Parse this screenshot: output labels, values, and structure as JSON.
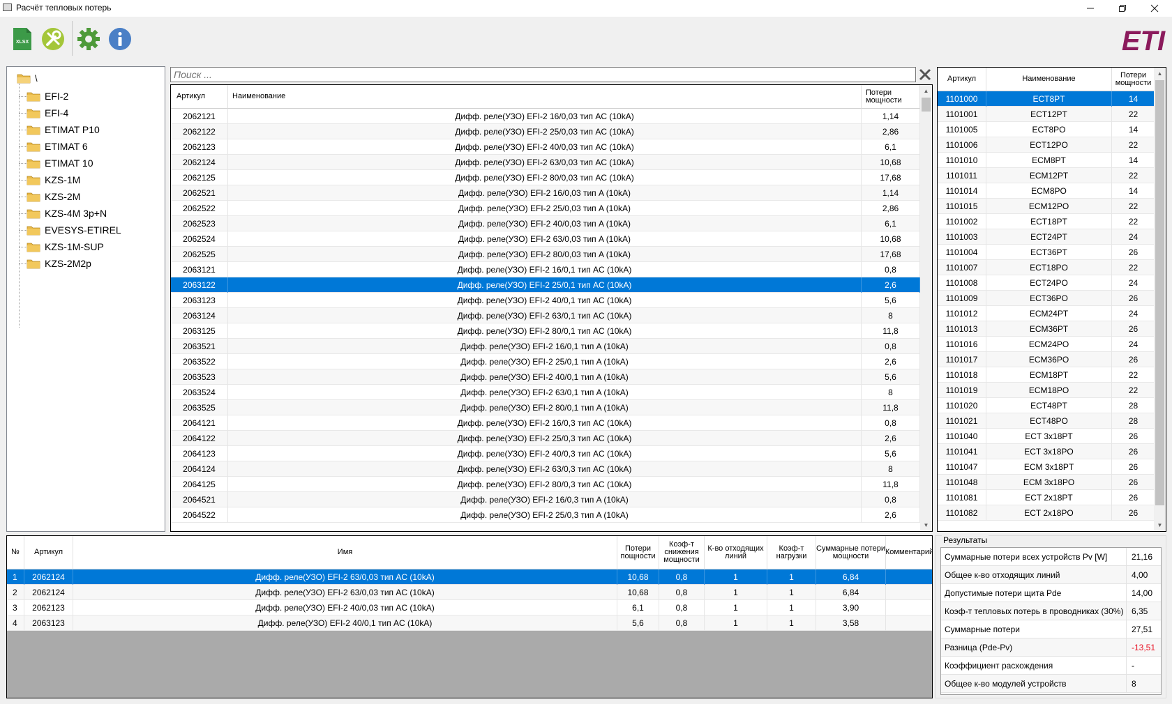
{
  "window": {
    "title": "Расчёт тепловых потерь",
    "brand": "ETI"
  },
  "toolbar": {
    "buttons": [
      {
        "name": "xlsx",
        "icon": "xlsx-file-icon",
        "label": "XLSX"
      },
      {
        "name": "tools",
        "icon": "tools-icon"
      },
      {
        "name": "settings",
        "icon": "gear-icon"
      },
      {
        "name": "info",
        "icon": "info-icon"
      }
    ]
  },
  "tree": {
    "root": "\\",
    "items": [
      "EFI-2",
      "EFI-4",
      "ETIMAT P10",
      "ETIMAT 6",
      "ETIMAT 10",
      "KZS-1M",
      "KZS-2M",
      "KZS-4M 3p+N",
      "EVESYS-ETIREL",
      "KZS-1M-SUP",
      "KZS-2M2p"
    ]
  },
  "search": {
    "placeholder": "Поиск ..."
  },
  "products": {
    "headers": [
      "Артикул",
      "Наименование",
      "Потери мощности"
    ],
    "selected_index": 11,
    "rows": [
      [
        "2062121",
        "Дифф. реле(УЗО) EFI-2 16/0,03 тип AC (10kA)",
        "1,14"
      ],
      [
        "2062122",
        "Дифф. реле(УЗО) EFI-2 25/0,03 тип AC (10kA)",
        "2,86"
      ],
      [
        "2062123",
        "Дифф. реле(УЗО) EFI-2 40/0,03 тип AC (10kA)",
        "6,1"
      ],
      [
        "2062124",
        "Дифф. реле(УЗО) EFI-2 63/0,03 тип AC (10kA)",
        "10,68"
      ],
      [
        "2062125",
        "Дифф. реле(УЗО) EFI-2 80/0,03 тип AC (10kA)",
        "17,68"
      ],
      [
        "2062521",
        "Дифф. реле(УЗО) EFI-2 16/0,03 тип A (10kA)",
        "1,14"
      ],
      [
        "2062522",
        "Дифф. реле(УЗО) EFI-2 25/0,03 тип A (10kA)",
        "2,86"
      ],
      [
        "2062523",
        "Дифф. реле(УЗО) EFI-2 40/0,03 тип A (10kA)",
        "6,1"
      ],
      [
        "2062524",
        "Дифф. реле(УЗО) EFI-2 63/0,03 тип A (10kA)",
        "10,68"
      ],
      [
        "2062525",
        "Дифф. реле(УЗО) EFI-2 80/0,03 тип A (10kA)",
        "17,68"
      ],
      [
        "2063121",
        "Дифф. реле(УЗО) EFI-2 16/0,1 тип AC (10kA)",
        "0,8"
      ],
      [
        "2063122",
        "Дифф. реле(УЗО) EFI-2 25/0,1 тип AC (10kA)",
        "2,6"
      ],
      [
        "2063123",
        "Дифф. реле(УЗО) EFI-2 40/0,1 тип AC (10kA)",
        "5,6"
      ],
      [
        "2063124",
        "Дифф. реле(УЗО) EFI-2 63/0,1 тип AC (10kA)",
        "8"
      ],
      [
        "2063125",
        "Дифф. реле(УЗО) EFI-2 80/0,1 тип AC (10kA)",
        "11,8"
      ],
      [
        "2063521",
        "Дифф. реле(УЗО) EFI-2 16/0,1 тип A (10kA)",
        "0,8"
      ],
      [
        "2063522",
        "Дифф. реле(УЗО) EFI-2 25/0,1 тип A (10kA)",
        "2,6"
      ],
      [
        "2063523",
        "Дифф. реле(УЗО) EFI-2 40/0,1 тип A (10kA)",
        "5,6"
      ],
      [
        "2063524",
        "Дифф. реле(УЗО) EFI-2 63/0,1 тип A (10kA)",
        "8"
      ],
      [
        "2063525",
        "Дифф. реле(УЗО) EFI-2 80/0,1 тип A (10kA)",
        "11,8"
      ],
      [
        "2064121",
        "Дифф. реле(УЗО) EFI-2 16/0,3 тип AC (10kA)",
        "0,8"
      ],
      [
        "2064122",
        "Дифф. реле(УЗО) EFI-2 25/0,3 тип AC (10kA)",
        "2,6"
      ],
      [
        "2064123",
        "Дифф. реле(УЗО) EFI-2 40/0,3 тип AC (10kA)",
        "5,6"
      ],
      [
        "2064124",
        "Дифф. реле(УЗО) EFI-2 63/0,3 тип AC (10kA)",
        "8"
      ],
      [
        "2064125",
        "Дифф. реле(УЗО) EFI-2 80/0,3 тип AC (10kA)",
        "11,8"
      ],
      [
        "2064521",
        "Дифф. реле(УЗО) EFI-2 16/0,3 тип A (10kA)",
        "0,8"
      ],
      [
        "2064522",
        "Дифф. реле(УЗО) EFI-2 25/0,3 тип A (10kA)",
        "2,6"
      ]
    ]
  },
  "fixtures": {
    "headers": [
      "Артикул",
      "Наименование",
      "Потери мощности"
    ],
    "selected_index": 0,
    "rows": [
      [
        "1101000",
        "ECT8PT",
        "14"
      ],
      [
        "1101001",
        "ECT12PT",
        "22"
      ],
      [
        "1101005",
        "ECT8PO",
        "14"
      ],
      [
        "1101006",
        "ECT12PO",
        "22"
      ],
      [
        "1101010",
        "ECM8PT",
        "14"
      ],
      [
        "1101011",
        "ECM12PT",
        "22"
      ],
      [
        "1101014",
        "ECM8PO",
        "14"
      ],
      [
        "1101015",
        "ECM12PO",
        "22"
      ],
      [
        "1101002",
        "ECT18PT",
        "22"
      ],
      [
        "1101003",
        "ECT24PT",
        "24"
      ],
      [
        "1101004",
        "ECT36PT",
        "26"
      ],
      [
        "1101007",
        "ECT18PO",
        "22"
      ],
      [
        "1101008",
        "ECT24PO",
        "24"
      ],
      [
        "1101009",
        "ECT36PO",
        "26"
      ],
      [
        "1101012",
        "ECM24PT",
        "24"
      ],
      [
        "1101013",
        "ECM36PT",
        "26"
      ],
      [
        "1101016",
        "ECM24PO",
        "24"
      ],
      [
        "1101017",
        "ECM36PO",
        "26"
      ],
      [
        "1101018",
        "ECM18PT",
        "22"
      ],
      [
        "1101019",
        "ECM18PO",
        "22"
      ],
      [
        "1101020",
        "ECT48PT",
        "28"
      ],
      [
        "1101021",
        "ECT48PO",
        "28"
      ],
      [
        "1101040",
        "ECT 3x18PT",
        "26"
      ],
      [
        "1101041",
        "ECT 3x18PO",
        "26"
      ],
      [
        "1101047",
        "ECM 3x18PT",
        "26"
      ],
      [
        "1101048",
        "ECM 3x18PO",
        "26"
      ],
      [
        "1101081",
        "ECT 2x18PT",
        "26"
      ],
      [
        "1101082",
        "ECT 2x18PO",
        "26"
      ]
    ]
  },
  "selection": {
    "headers": [
      "№",
      "Артикул",
      "Имя",
      "Потери пощности",
      "Коэф-т снижения мощности",
      "К-во отходящих линий",
      "Коэф-т нагрузки",
      "Суммарные потери мощности",
      "Комментарий"
    ],
    "selected_index": 0,
    "rows": [
      [
        "1",
        "2062124",
        "Дифф. реле(УЗО) EFI-2 63/0,03 тип AC (10kA)",
        "10,68",
        "0,8",
        "1",
        "1",
        "6,84",
        ""
      ],
      [
        "2",
        "2062124",
        "Дифф. реле(УЗО) EFI-2 63/0,03 тип AC (10kA)",
        "10,68",
        "0,8",
        "1",
        "1",
        "6,84",
        ""
      ],
      [
        "3",
        "2062123",
        "Дифф. реле(УЗО) EFI-2 40/0,03 тип AC (10kA)",
        "6,1",
        "0,8",
        "1",
        "1",
        "3,90",
        ""
      ],
      [
        "4",
        "2063123",
        "Дифф. реле(УЗО) EFI-2 40/0,1 тип AC (10kA)",
        "5,6",
        "0,8",
        "1",
        "1",
        "3,58",
        ""
      ]
    ]
  },
  "results": {
    "title": "Результаты",
    "rows": [
      {
        "label": "Суммарные потери всех устройств Pv [W]",
        "value": "21,16"
      },
      {
        "label": "Общее к-во отходящих линий",
        "value": "4,00"
      },
      {
        "label": "Допустимые потери щита Pde",
        "value": "14,00"
      },
      {
        "label": "Коэф-т тепловых потерь в проводниках (30%)",
        "value": "6,35"
      },
      {
        "label": "Суммарные потери",
        "value": "27,51"
      },
      {
        "label": "Разница (Pde-Pv)",
        "value": "-13,51",
        "color": "#e81123"
      },
      {
        "label": "Коэффициент расхождения",
        "value": "-"
      },
      {
        "label": "Общее к-во модулей устройств",
        "value": "8"
      }
    ]
  },
  "colors": {
    "selection": "#0078d7",
    "brand": "#8b1a5c",
    "xlsx_icon": "#3c9a48",
    "tools_icon": "#a4c639",
    "gear_icon": "#4e9a39",
    "info_icon": "#4a7fc6"
  }
}
